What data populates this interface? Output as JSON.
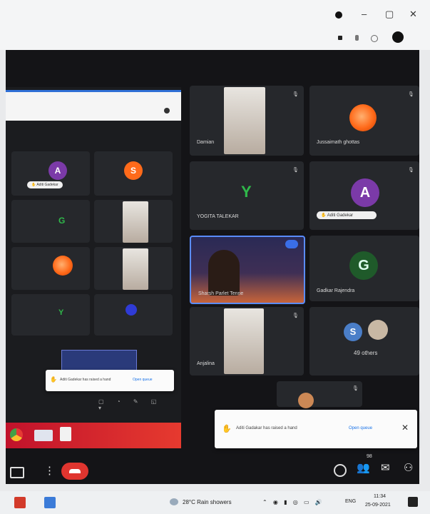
{
  "participants": [
    {
      "name": "Damian"
    },
    {
      "name": "Jussaimath ghottas"
    },
    {
      "name": "YOGITA TALEKAR",
      "initial": "Y"
    },
    {
      "name": "",
      "initial": "A"
    },
    {
      "name": "Sharsh Parlet Tenne"
    },
    {
      "name": "Gadkar Rajendra",
      "initial": "G"
    },
    {
      "name": "Anjalina"
    },
    {
      "name": "",
      "initial": "S"
    }
  ],
  "others": {
    "label": "49 others",
    "initial": "S"
  },
  "left_panel": {
    "initials": [
      "A",
      "S",
      "G",
      "Y"
    ]
  },
  "notification": {
    "text": "Aditi Gadakar has raised a hand",
    "action": "Open queue",
    "close": "✕"
  },
  "left_notification": {
    "text": "Aditi Gadekar has raised a hand",
    "action": "Open queue"
  },
  "controls": {
    "more": "⋮",
    "hand_count": "98"
  },
  "taskbar": {
    "weather": "28°C  Rain showers",
    "lang": "ENG",
    "time": "11:34",
    "date": "25-09-2021"
  },
  "colors": {
    "hangup": "#e0352f",
    "accent": "#1a73e8",
    "purple": "#7b3aa8",
    "green": "#1f5a2a"
  }
}
